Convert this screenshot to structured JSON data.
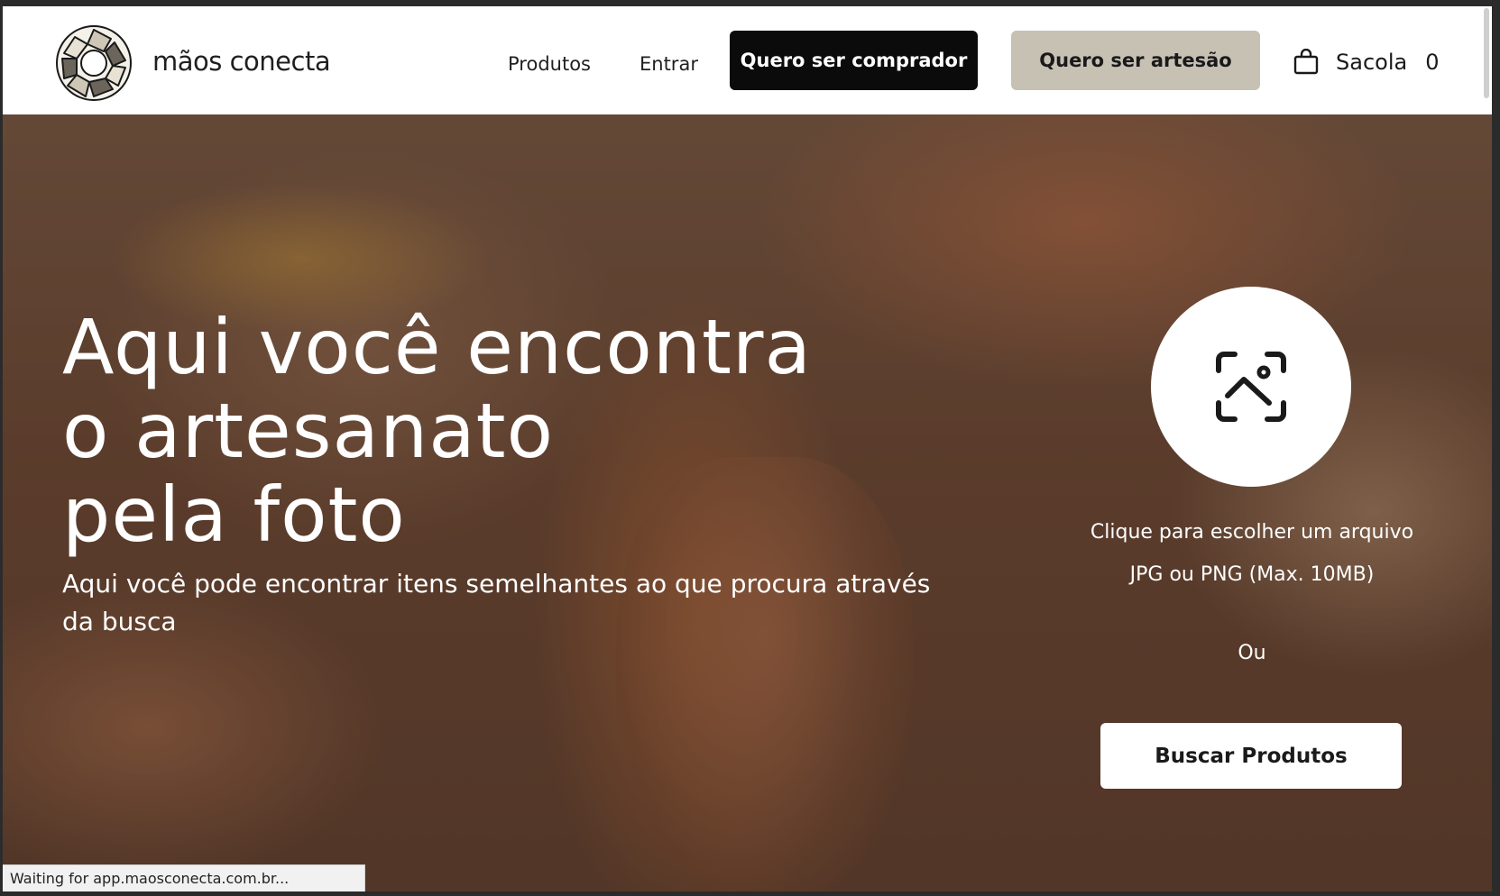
{
  "header": {
    "brand": "mãos conecta",
    "nav": {
      "products": "Produtos",
      "login": "Entrar"
    },
    "buyer_button": "Quero ser comprador",
    "artisan_button": "Quero ser artesão",
    "bag": {
      "label": "Sacola",
      "count": "0"
    }
  },
  "hero": {
    "headline_lines": [
      "Aqui você encontra",
      "o artesanato",
      "pela foto"
    ],
    "subtitle": "Aqui você pode encontrar itens semelhantes ao que procura através da busca",
    "upload": {
      "caption_line1": "Clique para escolher um arquivo",
      "caption_line2": "JPG ou PNG (Max. 10MB)"
    },
    "or_text": "Ou",
    "search_button": "Buscar Produtos"
  },
  "status_bar": "Waiting for app.maosconecta.com.br...",
  "icons": {
    "logo": "interlocking-hands-logo",
    "bag": "shopping-bag-icon",
    "image_search": "image-scan-icon"
  },
  "colors": {
    "primary_button": "#0b0b0b",
    "secondary_button": "#c7c1b4",
    "text_dark": "#1a1a1a",
    "hero_text": "#ffffff"
  }
}
